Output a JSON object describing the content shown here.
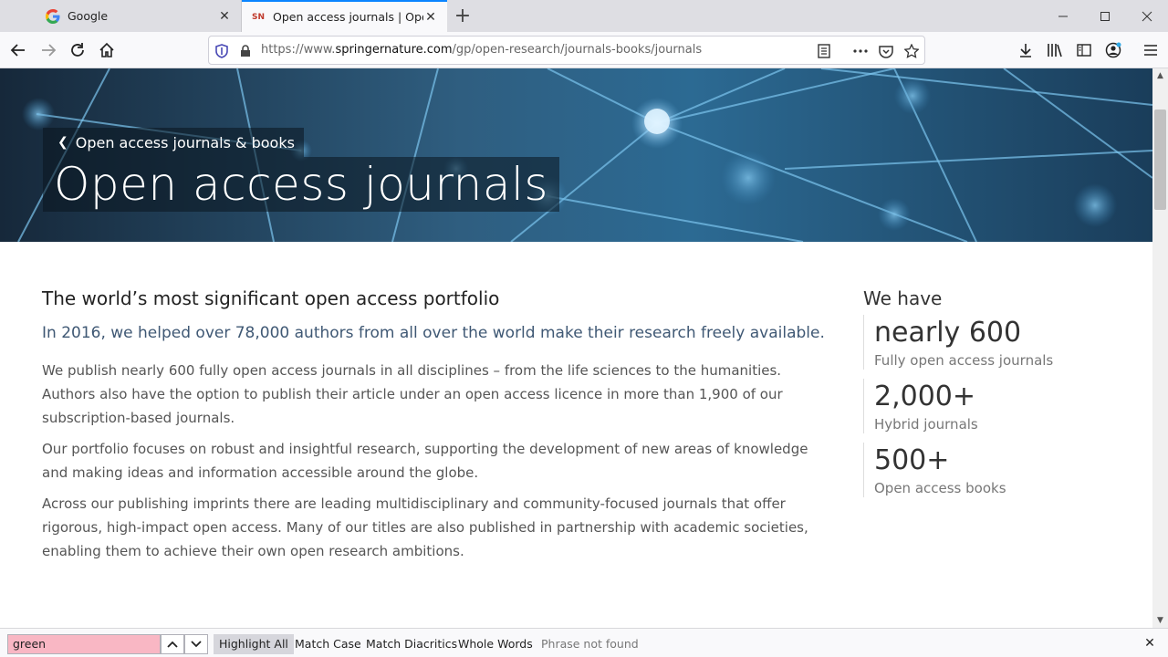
{
  "browser": {
    "tabs": [
      {
        "title": "Google",
        "favicon": "google-icon",
        "active": false
      },
      {
        "title": "Open access journals | Open re",
        "favicon": "springer-nature-icon",
        "favicon_text": "SN",
        "active": true
      }
    ],
    "url": {
      "scheme": "https://www.",
      "host": "springernature.com",
      "path": "/gp/open-research/journals-books/journals"
    }
  },
  "hero": {
    "breadcrumb": "Open access journals & books",
    "title": "Open access journals"
  },
  "main": {
    "heading": "The world’s most significant open access portfolio",
    "lead": "In 2016, we helped over 78,000 authors from all over the world make their research freely available.",
    "paragraphs": [
      "We publish nearly 600 fully open access journals in all disciplines – from the life sciences to the humanities. Authors also have the option to publish their article under an open access licence in more than 1,900 of our subscription-based journals.",
      "Our portfolio focuses on robust and insightful research, supporting the development of new areas of knowledge and making ideas and information accessible around the globe.",
      "Across our publishing imprints there are leading multidisciplinary and community-focused journals that offer rigorous, high-impact open access. Many of our titles are also published in partnership with academic societies, enabling them to achieve their own open research ambitions."
    ]
  },
  "sidebar": {
    "heading": "We have",
    "stats": [
      {
        "value": "nearly 600",
        "label": "Fully open access journals"
      },
      {
        "value": "2,000+",
        "label": "Hybrid journals"
      },
      {
        "value": "500+",
        "label": "Open access books"
      }
    ]
  },
  "findbar": {
    "query": "green",
    "highlight_all": "Highlight All",
    "match_case": "Match Case",
    "match_diacritics": "Match Diacritics",
    "whole_words": "Whole Words",
    "status": "Phrase not found"
  }
}
